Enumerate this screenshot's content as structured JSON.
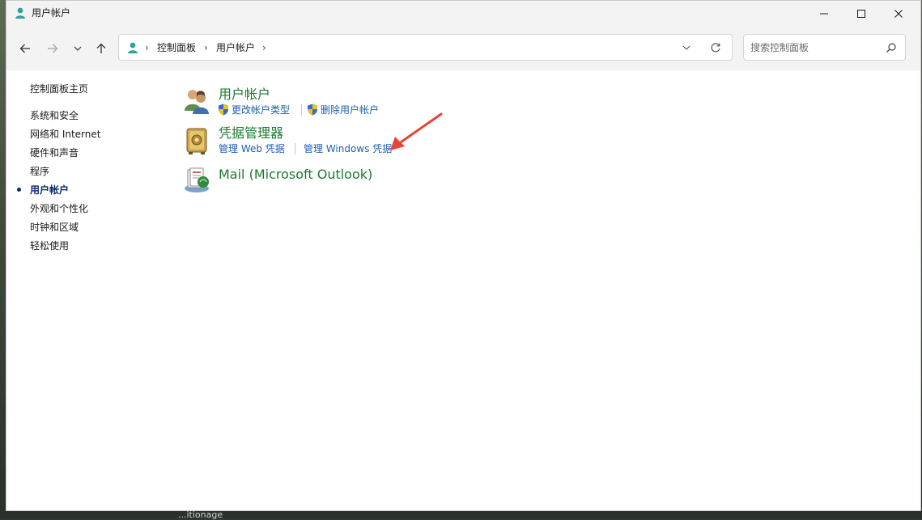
{
  "window": {
    "title": "用户帐户"
  },
  "nav": {
    "breadcrumb": [
      "控制面板",
      "用户帐户"
    ]
  },
  "search": {
    "placeholder": "搜索控制面板"
  },
  "sidebar": {
    "home_label": "控制面板主页",
    "items": [
      {
        "label": "系统和安全"
      },
      {
        "label": "网络和 Internet"
      },
      {
        "label": "硬件和声音"
      },
      {
        "label": "程序"
      },
      {
        "label": "用户帐户",
        "active": true
      },
      {
        "label": "外观和个性化"
      },
      {
        "label": "时钟和区域"
      },
      {
        "label": "轻松使用"
      }
    ]
  },
  "categories": [
    {
      "title": "用户帐户",
      "icon": "users-icon",
      "links": [
        {
          "label": "更改帐户类型",
          "shield": true
        },
        {
          "label": "删除用户帐户",
          "shield": true
        }
      ]
    },
    {
      "title": "凭据管理器",
      "icon": "credential-vault-icon",
      "links": [
        {
          "label": "管理 Web 凭据"
        },
        {
          "label": "管理 Windows 凭据"
        }
      ]
    },
    {
      "title": "Mail (Microsoft Outlook)",
      "icon": "mail-icon",
      "links": []
    }
  ],
  "colors": {
    "category_title": "#1b7a2e",
    "link": "#1d5fb0",
    "annotation_arrow": "#e8423a"
  },
  "taskbar": {
    "partial_text": "...itionage"
  }
}
